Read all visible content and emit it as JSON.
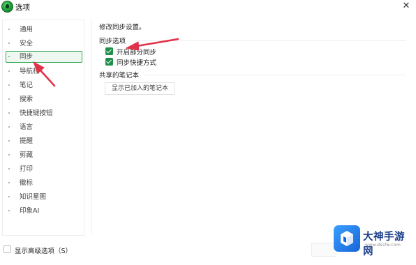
{
  "window": {
    "title": "选项",
    "close_glyph": "✕"
  },
  "sidebar": {
    "items": [
      {
        "label": "通用",
        "active": false
      },
      {
        "label": "安全",
        "active": false
      },
      {
        "label": "同步",
        "active": true
      },
      {
        "label": "导航栏",
        "active": false
      },
      {
        "label": "笔记",
        "active": false
      },
      {
        "label": "搜索",
        "active": false
      },
      {
        "label": "快捷键按钮",
        "active": false
      },
      {
        "label": "语言",
        "active": false
      },
      {
        "label": "提醒",
        "active": false
      },
      {
        "label": "剪藏",
        "active": false
      },
      {
        "label": "打印",
        "active": false
      },
      {
        "label": "徽标",
        "active": false
      },
      {
        "label": "知识星图",
        "active": false
      },
      {
        "label": "印象AI",
        "active": false
      }
    ]
  },
  "content": {
    "page_title": "修改同步设置。",
    "sync_section": {
      "header": "同步选项",
      "options": [
        {
          "label": "开启部分同步",
          "checked": true
        },
        {
          "label": "同步快捷方式",
          "checked": true
        }
      ]
    },
    "shared_section": {
      "header": "共享的笔记本",
      "button_label": "显示已加入的笔记本"
    }
  },
  "footer": {
    "advanced_label": "显示高级选项（S）",
    "advanced_checked": false
  },
  "watermark": {
    "title": "大神手游网",
    "url": "www.dssfw.com"
  },
  "colors": {
    "accent": "#1e8f48",
    "annotation_arrow": "#e0334a",
    "watermark_blue": "#1764d8"
  }
}
